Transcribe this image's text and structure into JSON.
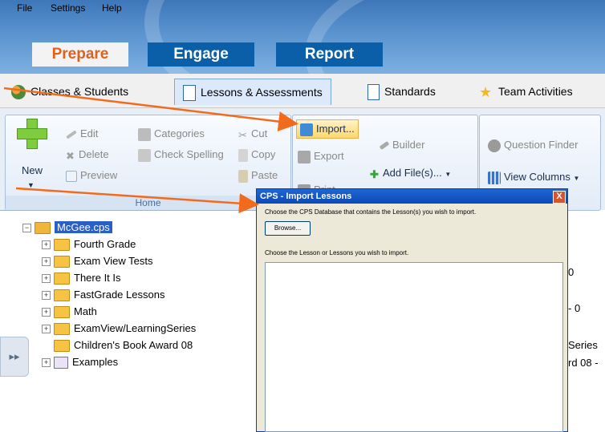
{
  "menu": {
    "file": "File",
    "settings": "Settings",
    "help": "Help"
  },
  "main_tabs": {
    "prepare": "Prepare",
    "engage": "Engage",
    "report": "Report"
  },
  "sub_tabs": {
    "classes": "Classes & Students",
    "lessons": "Lessons & Assessments",
    "standards": "Standards",
    "team": "Team Activities"
  },
  "ribbon": {
    "new": "New",
    "edit": "Edit",
    "delete": "Delete",
    "preview": "Preview",
    "categories": "Categories",
    "check_spelling": "Check Spelling",
    "cut": "Cut",
    "copy": "Copy",
    "paste": "Paste",
    "import": "Import...",
    "export": "Export",
    "print": "Print...",
    "builder": "Builder",
    "add_files": "Add File(s)...",
    "question_finder": "Question Finder",
    "view_columns": "View Columns",
    "home_group": "Home"
  },
  "tree": {
    "root": "McGee.cps",
    "items": [
      "Fourth Grade",
      "Exam View Tests",
      "There It Is",
      "FastGrade Lessons",
      "Math",
      "ExamView/LearningSeries",
      "Children's Book Award 08",
      "Examples"
    ]
  },
  "background_list": {
    "frag1": "0",
    "frag2": "- 0",
    "frag3": "Series",
    "frag4": "rd 08 -"
  },
  "dialog": {
    "title": "CPS - Import Lessons",
    "database_prompt": "Choose the CPS Database that contains the Lesson(s) you wish to import.",
    "browse": "Browse...",
    "lesson_prompt": "Choose the Lesson or Lessons you wish to import.",
    "close": "X"
  },
  "colors": {
    "accent_orange": "#f26b1d",
    "title_blue": "#0d49b5",
    "prepare_orange": "#e0601e"
  }
}
